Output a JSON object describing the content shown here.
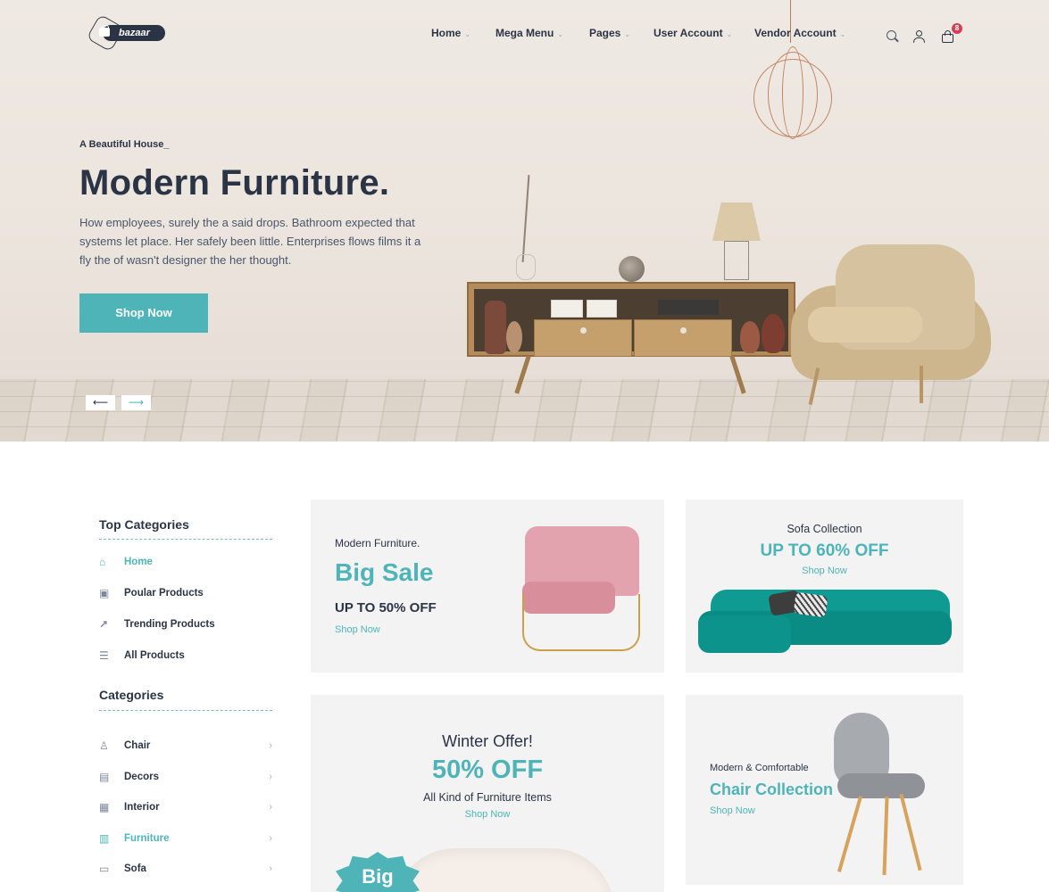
{
  "brand": {
    "logo_text": "bazaar"
  },
  "nav": [
    {
      "label": "Home",
      "caret": "⌄"
    },
    {
      "label": "Mega Menu",
      "caret": "⌄"
    },
    {
      "label": "Pages",
      "caret": "⌄"
    },
    {
      "label": "User Account",
      "caret": "⌄"
    },
    {
      "label": "Vendor Account",
      "caret": "⌄"
    }
  ],
  "header_icons": {
    "search": "search-icon",
    "user": "user-icon",
    "cart": "shopping-bag-icon",
    "cart_count": "8"
  },
  "hero": {
    "kicker": "A Beautiful House_",
    "title": "Modern Furniture.",
    "description": "How employees, surely the a said drops. Bathroom expected that systems let place. Her safely been little. Enterprises flows films it a fly the of wasn't designer the her thought.",
    "button": "Shop Now",
    "prev": "⟵",
    "next": "⟶"
  },
  "sidebar": {
    "top_title": "Top Categories",
    "top_items": [
      {
        "label": "Home",
        "icon": "⌂",
        "active": true
      },
      {
        "label": "Poular Products",
        "icon": "▣",
        "active": false
      },
      {
        "label": "Trending Products",
        "icon": "↗",
        "active": false
      },
      {
        "label": "All Products",
        "icon": "☰",
        "active": false
      }
    ],
    "cat_title": "Categories",
    "cat_items": [
      {
        "label": "Chair",
        "icon": "♙",
        "chev": "›",
        "active": false
      },
      {
        "label": "Decors",
        "icon": "▤",
        "chev": "›",
        "active": false
      },
      {
        "label": "Interior",
        "icon": "▦",
        "chev": "›",
        "active": false
      },
      {
        "label": "Furniture",
        "icon": "▥",
        "chev": "›",
        "active": true
      },
      {
        "label": "Sofa",
        "icon": "▭",
        "chev": "›",
        "active": false
      }
    ]
  },
  "promos": {
    "big_sale": {
      "kicker": "Modern Furniture.",
      "title": "Big Sale",
      "subtitle": "UP TO 50% OFF",
      "link": "Shop Now"
    },
    "sofa": {
      "kicker": "Sofa Collection",
      "title": "UP TO 60% OFF",
      "link": "Shop Now"
    },
    "winter": {
      "kicker": "Winter Offer!",
      "title": "50% OFF",
      "subtitle": "All Kind of Furniture Items",
      "link": "Shop Now",
      "badge": "Big"
    },
    "chair": {
      "kicker": "Modern & Comfortable",
      "title": "Chair Collection",
      "link": "Shop Now"
    }
  },
  "colors": {
    "accent": "#4eb4b7",
    "text": "#2b3445",
    "badge": "#d23f57",
    "card_bg": "#f3f3f3"
  }
}
